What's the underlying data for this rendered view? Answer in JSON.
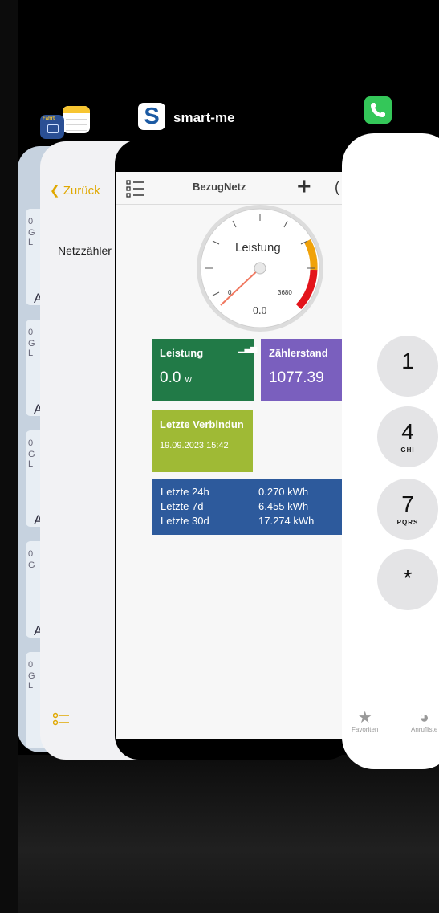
{
  "colors": {
    "smartme_green": "#217a47",
    "smartme_purple": "#7a5fbe",
    "smartme_lime": "#9fba35",
    "smartme_blue": "#2d5a9c",
    "notes_accent": "#e0a800",
    "phone_green": "#34c759"
  },
  "switcher": {
    "app_label": "smart-me",
    "icons": [
      "notes-app-icon",
      "fahrtenbuch-app-icon",
      "smart-me-app-icon",
      "phone-app-icon"
    ]
  },
  "fahrt_icon_text": "Fahrt",
  "notes": {
    "back_label": "Zurück",
    "title": "Netzzähler"
  },
  "smartme": {
    "nav_title": "BezugNetz",
    "nav_add": "+",
    "nav_edge": "(",
    "gauge": {
      "title": "Leistung",
      "value": "0.0",
      "min_label": "0",
      "max_label": "3680",
      "level": 0.0
    },
    "leistung_tile": {
      "title": "Leistung",
      "value": "0.0",
      "unit": "w"
    },
    "zaehler_tile": {
      "title": "Zählerstand",
      "value": "1077.39"
    },
    "verbindung_tile": {
      "title": "Letzte Verbindun",
      "date": "19.09.2023 15:42"
    },
    "stats": [
      {
        "label": "Letzte 24h",
        "value": "0.270 kWh"
      },
      {
        "label": "Letzte 7d",
        "value": "6.455 kWh"
      },
      {
        "label": "Letzte 30d",
        "value": "17.274 kWh"
      }
    ]
  },
  "phone": {
    "keys": [
      {
        "digit": "1",
        "letters": ""
      },
      {
        "digit": "4",
        "letters": "GHI"
      },
      {
        "digit": "7",
        "letters": "PQRS"
      },
      {
        "digit": "*",
        "letters": ""
      }
    ],
    "tabs": [
      {
        "label": "Favoriten",
        "icon": "star-icon"
      },
      {
        "label": "Anrufliste",
        "icon": "clock-icon"
      }
    ]
  },
  "blue_card": {
    "rows": [
      {
        "line1": "0",
        "line2": "G",
        "line3": "L",
        "big": "A"
      },
      {
        "line1": "0",
        "line2": "G",
        "line3": "L",
        "big": "A"
      },
      {
        "line1": "0",
        "line2": "G",
        "line3": "L",
        "big": "A"
      },
      {
        "line1": "0",
        "line2": "G",
        "line3": "",
        "big": "A"
      },
      {
        "line1": "0",
        "line2": "G",
        "line3": "L",
        "big": ""
      }
    ]
  }
}
